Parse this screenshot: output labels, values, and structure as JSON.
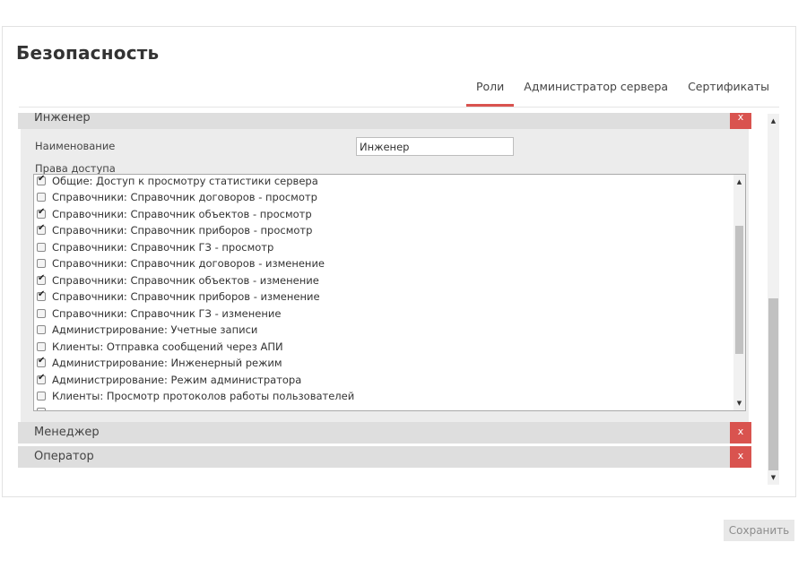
{
  "page": {
    "title": "Безопасность"
  },
  "tabs": [
    {
      "label": "Роли",
      "active": true
    },
    {
      "label": "Администратор сервера",
      "active": false
    },
    {
      "label": "Сертификаты",
      "active": false
    }
  ],
  "roles": [
    {
      "name": "Инженер",
      "delete_label": "x",
      "expanded": true,
      "name_field_label": "Наименование",
      "name_value": "Инженер",
      "permissions_label": "Права доступа",
      "permissions": [
        {
          "label": "Общие: Доступ к просмотру статистики сервера",
          "checked": true
        },
        {
          "label": "Справочники: Справочник договоров - просмотр",
          "checked": false
        },
        {
          "label": "Справочники: Справочник объектов - просмотр",
          "checked": true
        },
        {
          "label": "Справочники: Справочник приборов - просмотр",
          "checked": true
        },
        {
          "label": "Справочники: Справочник ГЗ - просмотр",
          "checked": false
        },
        {
          "label": "Справочники: Справочник договоров - изменение",
          "checked": false
        },
        {
          "label": "Справочники: Справочник объектов - изменение",
          "checked": true
        },
        {
          "label": "Справочники: Справочник приборов - изменение",
          "checked": true
        },
        {
          "label": "Справочники: Справочник ГЗ - изменение",
          "checked": false
        },
        {
          "label": "Администрирование: Учетные записи",
          "checked": false
        },
        {
          "label": "Клиенты: Отправка сообщений через АПИ",
          "checked": false
        },
        {
          "label": "Администрирование: Инженерный режим",
          "checked": true
        },
        {
          "label": "Администрирование: Режим администратора",
          "checked": true
        },
        {
          "label": "Клиенты: Просмотр протоколов работы пользователей",
          "checked": false
        }
      ]
    },
    {
      "name": "Менеджер",
      "delete_label": "x",
      "expanded": false
    },
    {
      "name": "Оператор",
      "delete_label": "x",
      "expanded": false
    }
  ],
  "scroll_arrows": {
    "up": "▲",
    "down": "▼"
  },
  "save_button": {
    "label": "Сохранить",
    "enabled": false
  },
  "colors": {
    "accent": "#d9534f",
    "role_header_bg": "#dedede",
    "role_body_bg": "#ececec"
  }
}
